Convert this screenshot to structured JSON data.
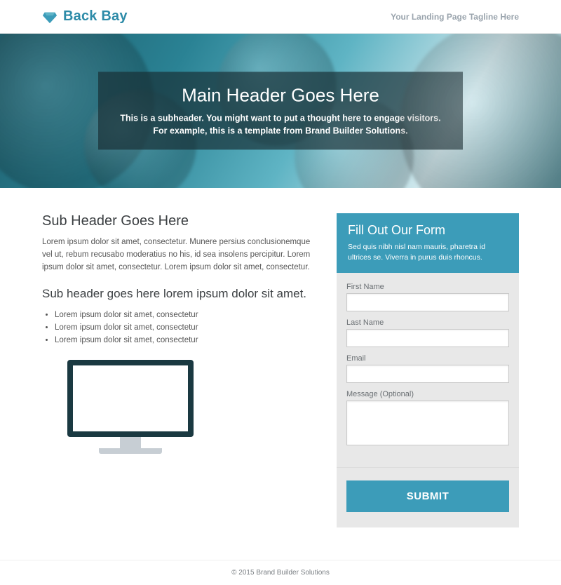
{
  "header": {
    "brand_name": "Back Bay",
    "tagline": "Your Landing Page Tagline Here"
  },
  "hero": {
    "title": "Main Header Goes Here",
    "subtitle": "This is a subheader. You might want to put a thought here to engage visitors. For example, this is a template from Brand Builder Solutions."
  },
  "content": {
    "subheader1": "Sub Header Goes Here",
    "paragraph1": "Lorem ipsum dolor sit amet, consectetur. Munere persius conclusionemque vel ut, rebum recusabo moderatius no his, id sea insolens percipitur. Lorem ipsum dolor sit amet, consectetur. Lorem ipsum dolor sit amet, consectetur.",
    "subheader2": "Sub header goes here lorem ipsum dolor sit amet.",
    "bullets": [
      "Lorem ipsum dolor sit amet, consectetur",
      "Lorem ipsum dolor sit amet, consectetur",
      "Lorem ipsum dolor sit amet, consectetur"
    ]
  },
  "form": {
    "title": "Fill Out Our Form",
    "description": "Sed quis nibh nisl nam mauris, pharetra id ultrices se. Viverra in purus duis rhoncus.",
    "fields": {
      "first_name_label": "First Name",
      "last_name_label": "Last Name",
      "email_label": "Email",
      "message_label": "Message (Optional)"
    },
    "submit_label": "SUBMIT"
  },
  "footer": {
    "copyright": "© 2015 Brand Builder Solutions"
  },
  "colors": {
    "accent": "#3c9cb9",
    "dark_teal": "#1a3941"
  }
}
